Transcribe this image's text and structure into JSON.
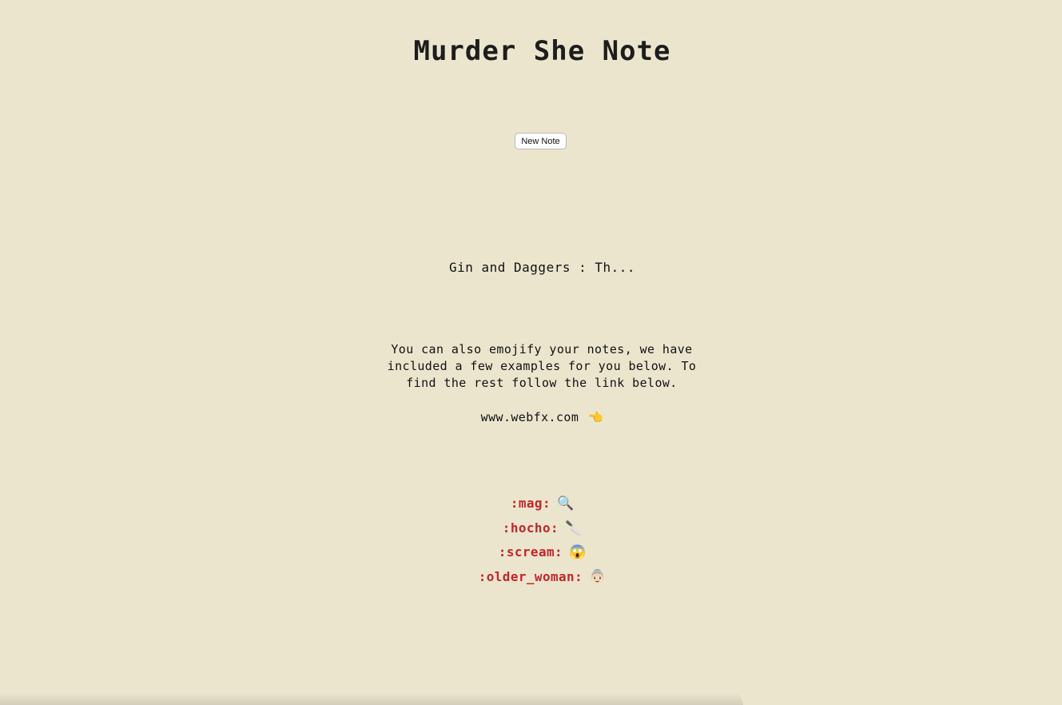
{
  "app": {
    "title": "Murder She Note"
  },
  "toolbar": {
    "new_note_label": "New Note"
  },
  "notes": [
    {
      "label": "Gin and Daggers : Th..."
    }
  ],
  "help": {
    "intro": "You can also emojify your notes, we have included a few examples for you below. To find the rest follow the link below.",
    "link_text": "www.webfx.com",
    "link_icon": "👈"
  },
  "emojis": [
    {
      "code": ":mag:",
      "glyph": "🔍",
      "icon": "magnifying-glass-icon"
    },
    {
      "code": ":hocho:",
      "glyph": "🔪",
      "icon": "kitchen-knife-icon"
    },
    {
      "code": ":scream:",
      "glyph": "😱",
      "icon": "screaming-face-icon"
    },
    {
      "code": ":older_woman:",
      "glyph": "👵🏻",
      "icon": "older-woman-icon"
    }
  ],
  "colors": {
    "background": "#ece5ce",
    "emoji_code": "#c0282a",
    "text": "#1c1c1c"
  }
}
